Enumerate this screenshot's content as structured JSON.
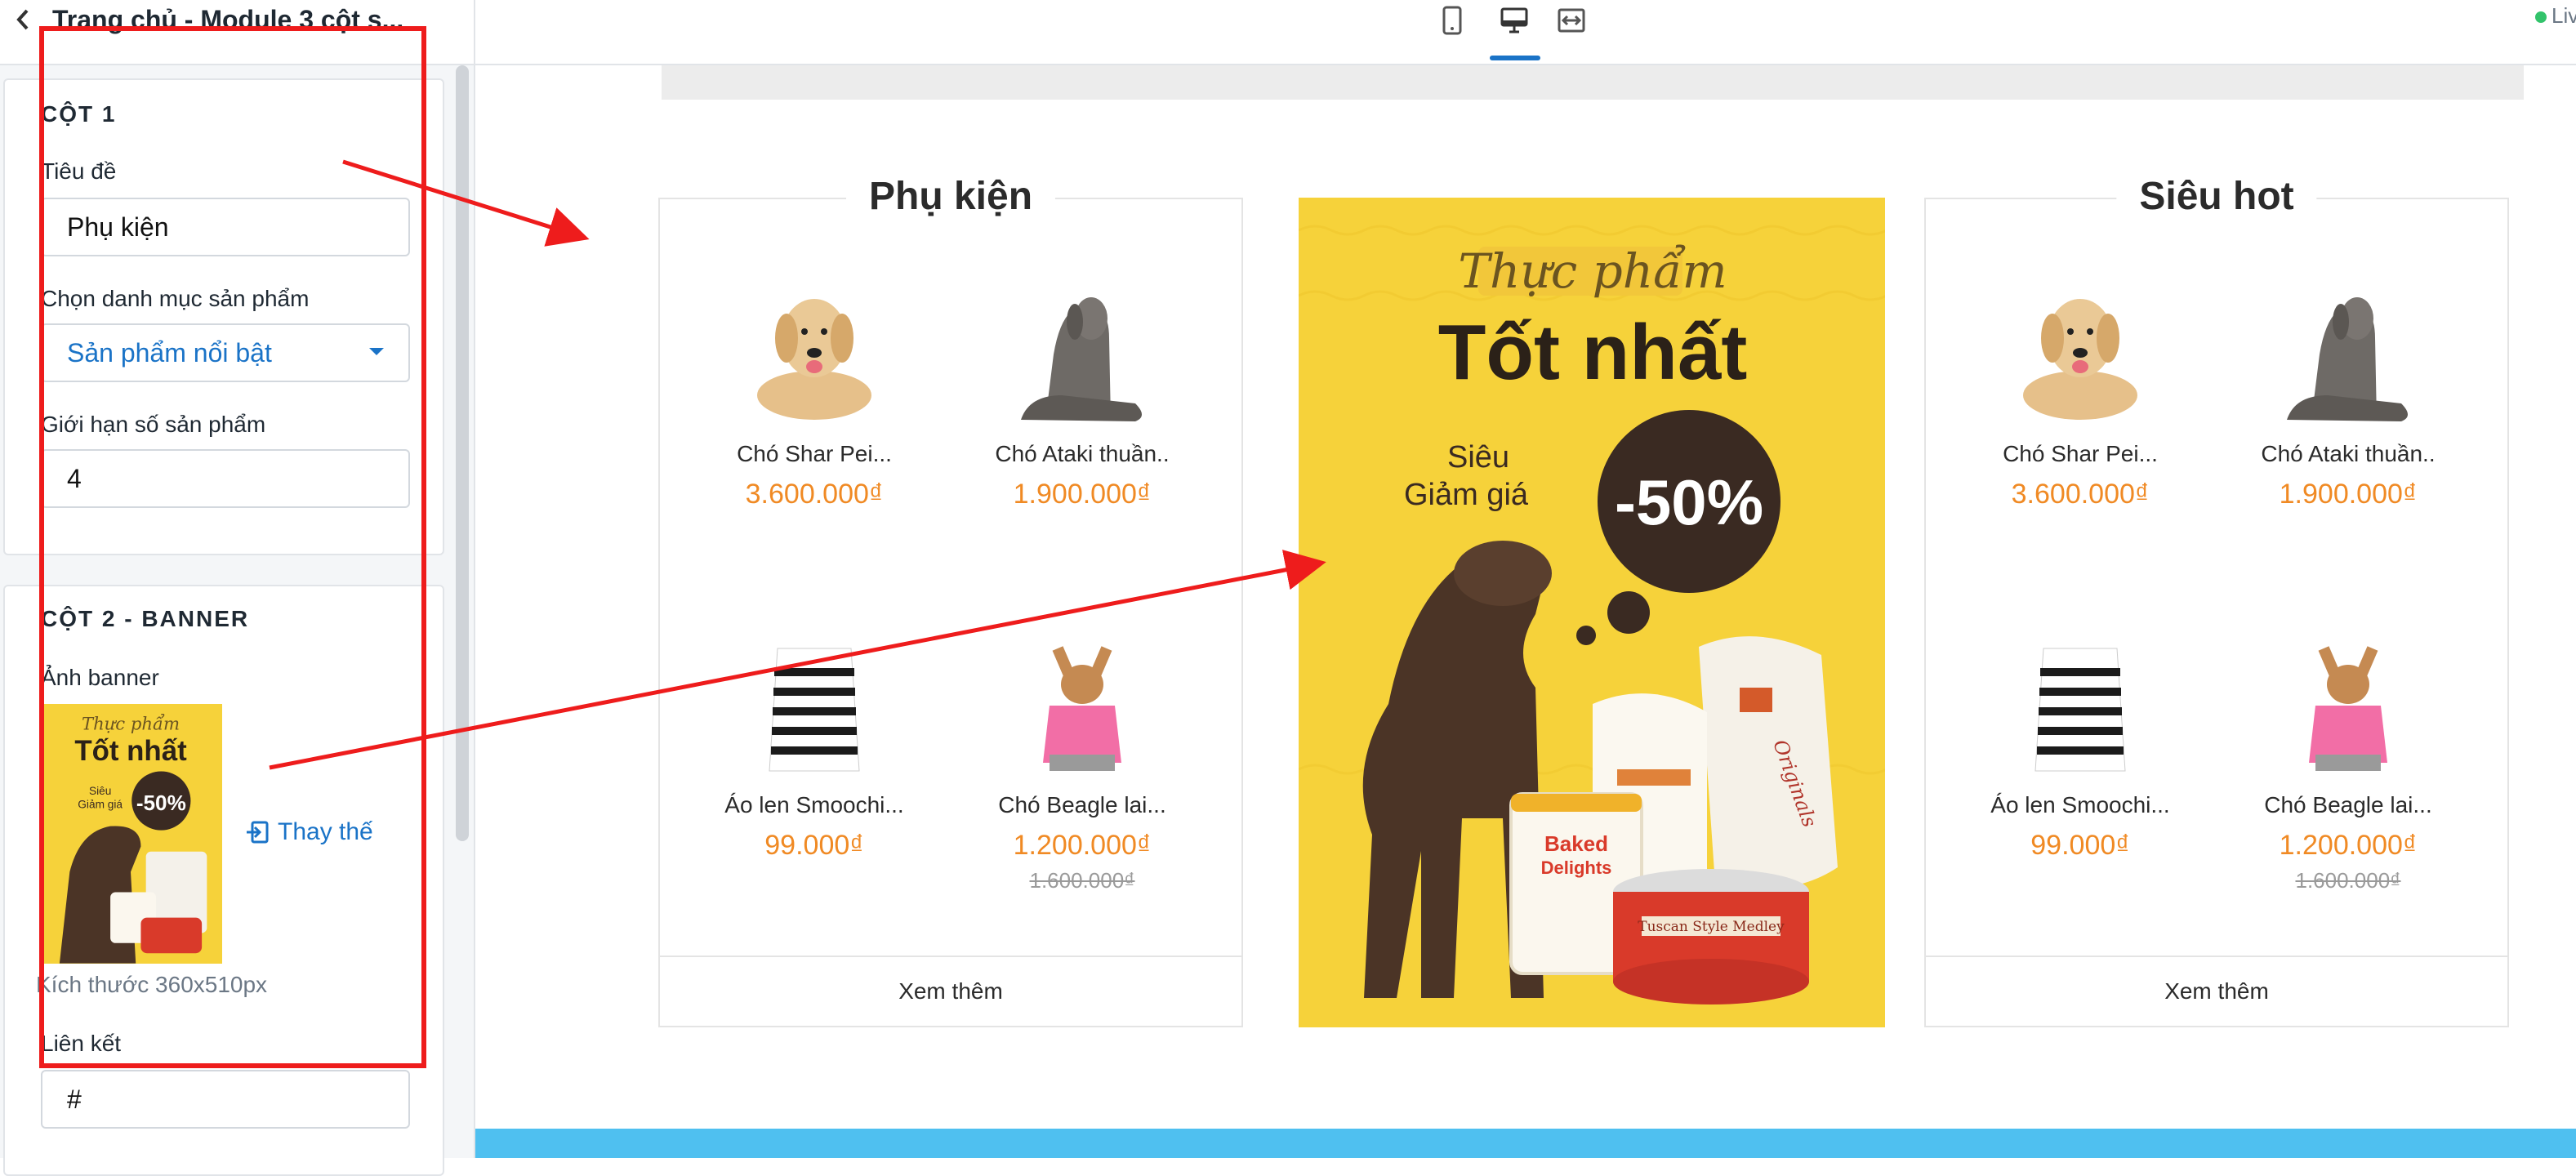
{
  "sidebar": {
    "title": "Trang chủ - Module 3 cột s...",
    "column1": {
      "heading": "CỘT 1",
      "title_label": "Tiêu đề",
      "title_value": "Phụ kiện",
      "category_label": "Chọn danh mục sản phẩm",
      "category_value": "Sản phẩm nổi bật",
      "limit_label": "Giới hạn số sản phẩm",
      "limit_value": "4"
    },
    "column2": {
      "heading": "CỘT 2 - BANNER",
      "image_label": "Ảnh banner",
      "replace_label": "Thay thế",
      "size_hint": "Kích thước 360x510px",
      "link_label": "Liên kết",
      "link_value": "#"
    }
  },
  "toolbar": {
    "views": [
      "mobile-icon",
      "desktop-icon",
      "fullwidth-icon"
    ],
    "active_view": "desktop",
    "status": "Live"
  },
  "banner": {
    "script_text": "Thực phẩm",
    "headline": "Tốt nhất",
    "sale_line1": "Siêu",
    "sale_line2": "Giảm giá",
    "discount": "-50%",
    "can_label1": "Baked",
    "can_label2": "Delights",
    "bag_label": "Originals",
    "tin_label": "Tuscan Style Medley"
  },
  "columns": [
    {
      "title": "Phụ kiện",
      "see_more": "Xem thêm",
      "products": [
        {
          "name": "Chó Shar Pei...",
          "price": "3.600.000₫",
          "old_price": "",
          "img": "golden-dog"
        },
        {
          "name": "Chó Ataki thuần..",
          "price": "1.900.000₫",
          "old_price": "",
          "img": "grey-dog"
        },
        {
          "name": "Áo len Smoochi...",
          "price": "99.000₫",
          "old_price": "",
          "img": "sweater"
        },
        {
          "name": "Chó Beagle lai...",
          "price": "1.200.000₫",
          "old_price": "1.600.000₫",
          "img": "chihuahua"
        }
      ]
    },
    {
      "title": "Siêu hot",
      "see_more": "Xem thêm",
      "products": [
        {
          "name": "Chó Shar Pei...",
          "price": "3.600.000₫",
          "old_price": "",
          "img": "golden-dog"
        },
        {
          "name": "Chó Ataki thuần..",
          "price": "1.900.000₫",
          "old_price": "",
          "img": "grey-dog"
        },
        {
          "name": "Áo len Smoochi...",
          "price": "99.000₫",
          "old_price": "",
          "img": "sweater"
        },
        {
          "name": "Chó Beagle lai...",
          "price": "1.200.000₫",
          "old_price": "1.600.000₫",
          "img": "chihuahua"
        }
      ]
    }
  ],
  "colors": {
    "accent": "#1a73c7",
    "price": "#f08a24",
    "banner_bg": "#f6d23a",
    "annotation": "#ee1c1c"
  }
}
